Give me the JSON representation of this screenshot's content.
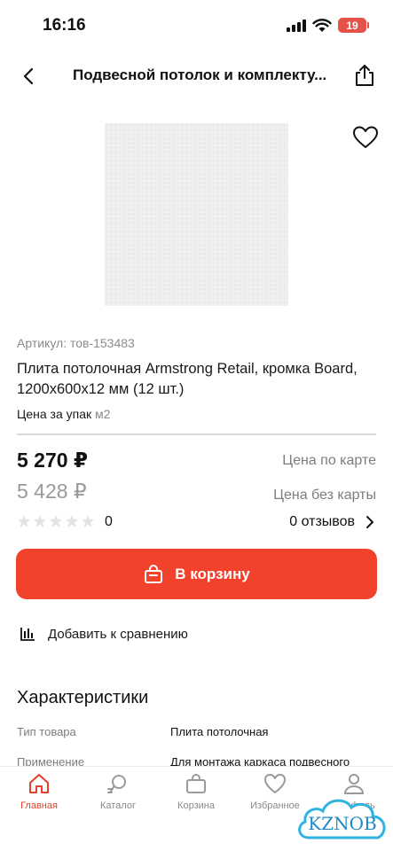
{
  "status_bar": {
    "time": "16:16",
    "battery": "19"
  },
  "header": {
    "title": "Подвесной потолок и комплекту..."
  },
  "product": {
    "sku": "Артикул: тов-153483",
    "title": "Плита потолочная Armstrong Retail, кромка Board, 1200x600x12 мм (12 шт.)",
    "price_per_label": "Цена за упак",
    "price_per_unit": "м2",
    "price_card": "5 270 ₽",
    "price_card_label": "Цена по карте",
    "price_nocard": "5 428 ₽",
    "price_nocard_label": "Цена без карты",
    "rating": 0,
    "rating_count": "0",
    "reviews_label": "0 отзывов"
  },
  "actions": {
    "cart_button": "В корзину",
    "compare_label": "Добавить к сравнению"
  },
  "specs": {
    "title": "Характеристики",
    "rows": [
      {
        "key": "Тип товара",
        "value": "Плита потолочная"
      },
      {
        "key": "Применение",
        "value": "Для монтажа каркаса подвесного"
      }
    ]
  },
  "tabbar": {
    "tabs": [
      {
        "label": "Главная",
        "icon": "home-icon",
        "active": true
      },
      {
        "label": "Каталог",
        "icon": "catalog-icon",
        "active": false
      },
      {
        "label": "Корзина",
        "icon": "cart-icon",
        "active": false
      },
      {
        "label": "Избранное",
        "icon": "heart-icon",
        "active": false
      },
      {
        "label": "Профиль",
        "icon": "profile-icon",
        "active": false
      }
    ]
  },
  "watermark": {
    "text": "KZNOB"
  },
  "colors": {
    "accent": "#f2422b",
    "active_tab": "#e5402b",
    "muted": "#8a8a8a"
  }
}
